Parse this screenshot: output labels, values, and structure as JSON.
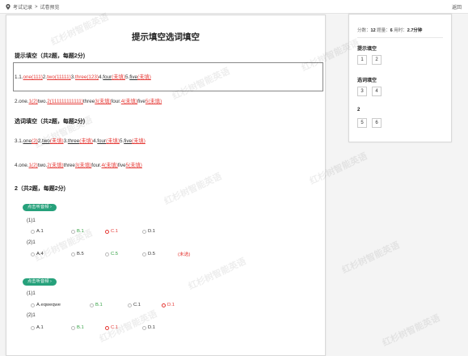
{
  "header": {
    "breadcrumb_parent": "考试记录",
    "breadcrumb_sep": ">",
    "breadcrumb_current": "试卷预览",
    "back": "返回"
  },
  "paper": {
    "title": "提示填空选词填空",
    "section1": "提示填空（共2题，每题2分)",
    "s1_line1": {
      "p1": "1.1.",
      "a1": "one(111)",
      "p2": "2.",
      "a2": "two(11111)",
      "p3": "3.",
      "a3": "three(123)",
      "p4": "4.",
      "a4a": "four",
      "a4b": "(未填)",
      "p5": "5.",
      "a5a": "five",
      "a5b": "(未填)"
    },
    "s1_line2": {
      "p1": "2.one.",
      "a1": "1(2)",
      "p2": "two.",
      "a2": "2(111111111111)",
      "p3": "three",
      "a3": "3(未填)",
      "p4": "four.",
      "a4": "4(未填)",
      "p5": "five",
      "a5": "5(未填)"
    },
    "section2": "选词填空（共2题，每题2分)",
    "s2_line1": {
      "p1": "3.1.",
      "a1a": "one",
      "a1b": "(2)",
      "p2": "2.",
      "a2a": "two",
      "a2b": "(未填)",
      "p3": "3.",
      "a3a": "three",
      "a3b": "(未填)",
      "p4": "4.",
      "a4a": "four",
      "a4b": "(未填)",
      "p5": "5.",
      "a5a": "five",
      "a5b": "(未填)"
    },
    "s2_line2": {
      "p1": "4.one.",
      "a1": "1(2)",
      "p2": "two.",
      "a2": "2(未填)",
      "p3": "three",
      "a3": "3(未填)",
      "p4": "four.",
      "a4": "4(未填)",
      "p5": "five",
      "a5": "5(未填)"
    },
    "section3": "2（共2题，每题2分)",
    "listen_label": "点击听音频 ›",
    "g1": {
      "q1": "(1)1",
      "q1_opts": [
        "A.1",
        "B.1",
        "C.1",
        "D.1"
      ],
      "q2": "(2)1",
      "q2_opts": [
        "A.4",
        "B.5",
        "C.5",
        "D.5"
      ],
      "q2_note": "(未选)"
    },
    "g2": {
      "q1": "(1)1",
      "q1_opts": [
        "A.eqweqwe",
        "B.1",
        "C.1",
        "D.1"
      ],
      "q2": "(2)1",
      "q2_opts": [
        "A.1",
        "B.1",
        "C.1",
        "D.1"
      ]
    }
  },
  "sidebar": {
    "stats_prefix1": "分数：",
    "score": "12",
    "stats_prefix2": " 题量：",
    "count": "6",
    "stats_prefix3": " 用时：",
    "time": "2.7分钟",
    "groups": [
      {
        "title": "提示填空",
        "items": [
          "1",
          "2"
        ]
      },
      {
        "title": "选词填空",
        "items": [
          "3",
          "4"
        ]
      },
      {
        "title": "2",
        "items": [
          "5",
          "6"
        ]
      }
    ]
  },
  "watermark": "红杉树智能英语",
  "colors": {
    "accent": "#26a17b",
    "wrong": "#e53935",
    "correct": "#2e9e3e"
  }
}
